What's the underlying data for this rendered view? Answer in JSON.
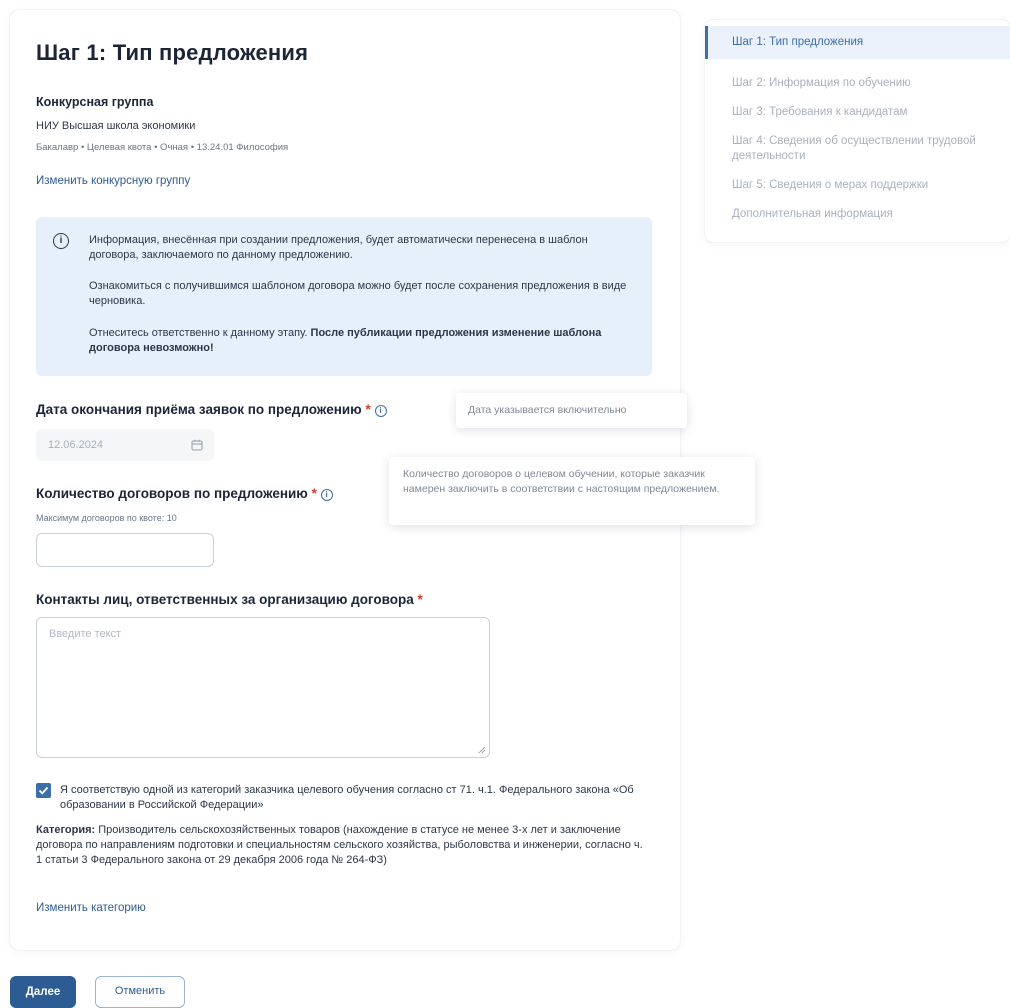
{
  "steps": [
    {
      "label": "Шаг 1: Тип предложения",
      "active": true
    },
    {
      "label": "Шаг 2: Информация по обучению"
    },
    {
      "label": "Шаг 3: Требования к кандидатам"
    },
    {
      "label": "Шаг 4: Сведения об осуществлении трудовой деятельности"
    },
    {
      "label": "Шаг 5: Сведения о мерах поддержки"
    },
    {
      "label": "Дополнительная информация"
    }
  ],
  "page_title": "Шаг 1: Тип предложения",
  "group": {
    "heading": "Конкурсная группа",
    "university": "НИУ Высшая школа экономики",
    "details": "Бакалавр • Целевая квота • Очная • 13.24.01 Философия",
    "change_link": "Изменить конкурсную группу"
  },
  "info": {
    "p1": "Информация, внесённая при создании предложения, будет автоматически перенесена в шаблон договора, заключаемого по данному предложению.",
    "p2": "Ознакомиться с получившимся шаблоном договора можно будет после сохранения предложения в виде черновика.",
    "p3_plain": "Отнеситесь ответственно к данному этапу. ",
    "p3_bold": "После публикации предложения изменение шаблона договора невозможно!"
  },
  "deadline": {
    "label": "Дата окончания приёма заявок по предложению",
    "required_mark": "*",
    "value": "12.06.2024",
    "tooltip": "Дата указывается включительно"
  },
  "contracts": {
    "label": "Количество договоров по предложению",
    "required_mark": "*",
    "hint": "Максимум договоров по квоте: 10",
    "value": "",
    "tooltip": "Количество договоров о целевом обучении, которые заказчик намерен заключить в соответствии с настоящим предложением."
  },
  "contacts": {
    "label": "Контакты лиц, ответственных за организацию договора",
    "required_mark": "*",
    "placeholder": "Введите текст"
  },
  "category": {
    "checked": true,
    "checkbox_label": "Я соответствую одной из категорий заказчика целевого обучения согласно ст 71. ч.1. Федерального закона «Об образовании в Российской Федерации»",
    "prefix": "Категория:",
    "text": "Производитель сельскохозяйственных товаров (нахождение в статусе не менее 3-х лет и заключение договора по направлениям подготовки и специальностям сельского хозяйства, рыболовства и инженерии, согласно ч. 1 статьи 3 Федерального закона от 29 декабря 2006 года № 264-ФЗ)",
    "change_link": "Изменить категорию"
  },
  "buttons": {
    "next": "Далее",
    "cancel": "Отменить"
  },
  "colors": {
    "accent": "#2d5b94",
    "info_bg": "#e6f0fb",
    "required": "#d23a2c"
  }
}
